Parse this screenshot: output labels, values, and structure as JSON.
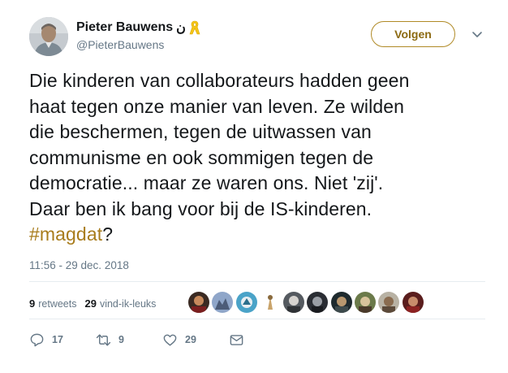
{
  "author": {
    "name": "Pieter Bauwens",
    "name_symbol": "ن",
    "handle": "@PieterBauwens"
  },
  "follow_button": {
    "label": "Volgen"
  },
  "tweet": {
    "lines": [
      "Die kinderen van collaborateurs hadden geen",
      "haat tegen onze manier van leven. Ze wilden",
      "die beschermen, tegen de uitwassen van",
      "communisme en ook sommigen tegen de",
      "democratie... maar ze waren ons. Niet 'zij'.",
      "Daar ben ik bang voor bij de IS-kinderen."
    ],
    "hashtag": "#magdat",
    "trailing": "?",
    "timestamp": "11:56 - 29 dec. 2018"
  },
  "stats": {
    "retweets_count": "9",
    "retweets_label": "retweets",
    "likes_count": "29",
    "likes_label": "vind-ik-leuks"
  },
  "actions": {
    "reply_count": "17",
    "retweet_count": "9",
    "like_count": "29"
  },
  "colors": {
    "accent": "#a87c1c",
    "text": "#14171a",
    "muted": "#657786",
    "divider": "#e6ecf0"
  }
}
